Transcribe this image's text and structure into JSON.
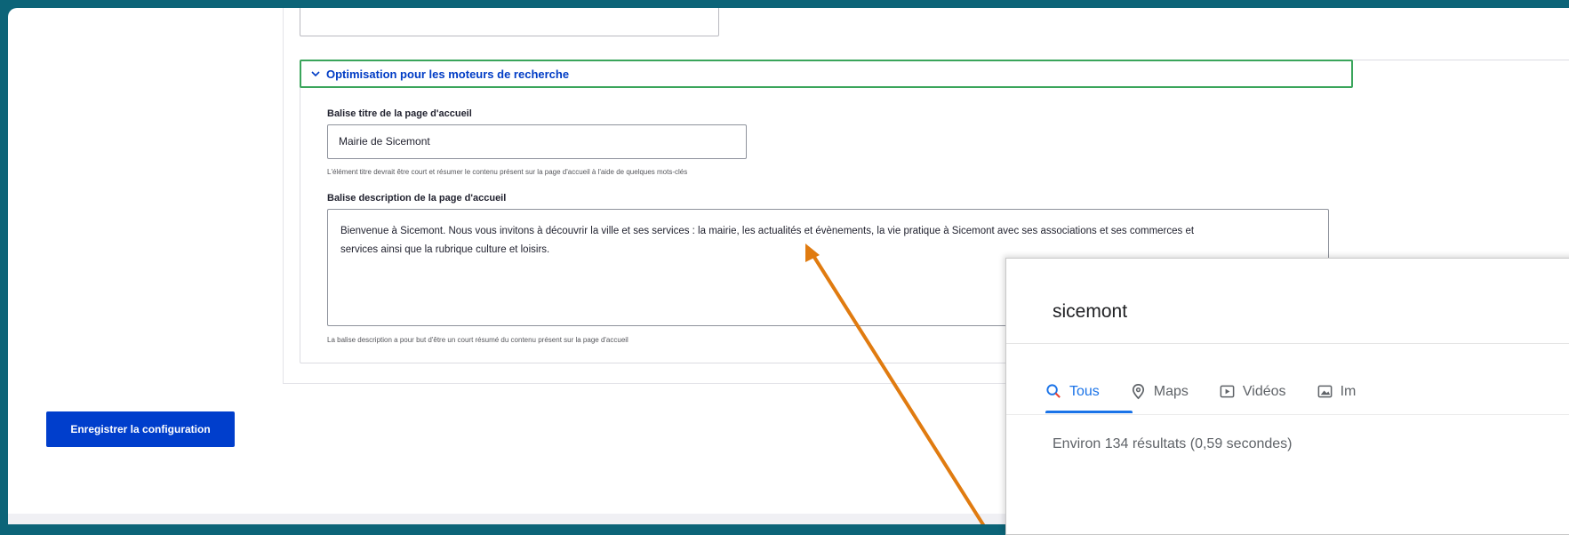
{
  "form": {
    "seo_section": {
      "summary_label": "Optimisation pour les moteurs de recherche",
      "title_label": "Balise titre de la page d'accueil",
      "title_value": "Mairie de Sicemont",
      "title_hint": "L'élément titre devrait être court et résumer le contenu présent sur la page d'accueil à l'aide de quelques mots-clés",
      "description_label": "Balise description de la page d'accueil",
      "description_line1": "Bienvenue à Sicemont. Nous vous invitons à découvrir la ville et ses services : la mairie, les actualités et évènements, la vie pratique à Sicemont avec ses associations et ses commerces et",
      "description_line2": "services ainsi que la rubrique culture et loisirs.",
      "description_hint": "La balise description a pour but d'être un court résumé du contenu présent sur la page d'accueil"
    },
    "save_button_label": "Enregistrer la configuration"
  },
  "google": {
    "query": "sicemont",
    "tabs": [
      {
        "label": "Tous",
        "icon": "search-icon",
        "active": true
      },
      {
        "label": "Maps",
        "icon": "map-pin-icon",
        "active": false
      },
      {
        "label": "Vidéos",
        "icon": "video-icon",
        "active": false
      },
      {
        "label": "Im",
        "icon": "image-icon",
        "active": false
      }
    ],
    "results_stats": "Environ 134 résultats (0,59 secondes)"
  },
  "colors": {
    "background_frame": "#0c6478",
    "save_button": "#003ecc",
    "summary_border": "#3aa55b",
    "summary_text": "#003cc5",
    "arrow": "#e07b10",
    "google_accent": "#1a73e8"
  }
}
